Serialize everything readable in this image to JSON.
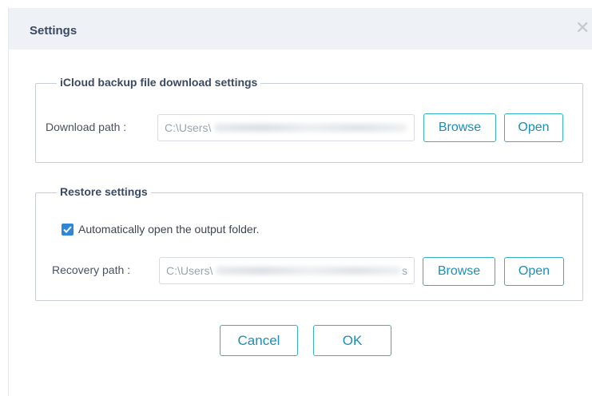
{
  "dialog": {
    "title": "Settings",
    "close_glyph": "✕"
  },
  "icloud": {
    "legend": "iCloud backup file download settings",
    "download_label": "Download path :",
    "download_value": "C:\\Users\\",
    "browse_label": "Browse",
    "open_label": "Open"
  },
  "restore": {
    "legend": "Restore settings",
    "auto_open_label": "Automatically open the output folder.",
    "auto_open_checked": true,
    "recovery_label": "Recovery path :",
    "recovery_value": "C:\\Users\\",
    "recovery_tail": "s",
    "browse_label": "Browse",
    "open_label": "Open"
  },
  "footer": {
    "cancel_label": "Cancel",
    "ok_label": "OK"
  },
  "colors": {
    "accent": "#2fb3c9",
    "button_text": "#1b8fb5",
    "checkbox": "#2f86d6",
    "titlebar_bg": "#eef1f5"
  },
  "icons": {
    "close": "close-icon",
    "check": "checkmark-icon"
  }
}
